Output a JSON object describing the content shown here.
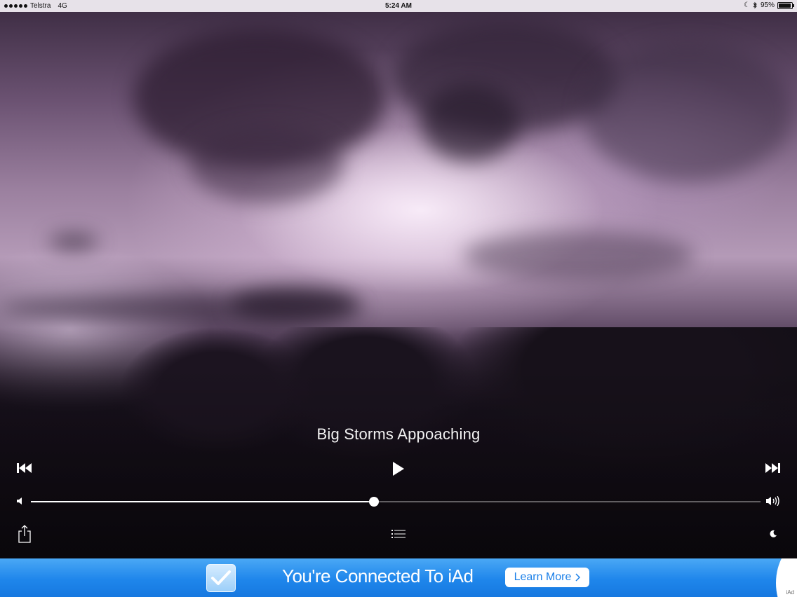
{
  "status_bar": {
    "carrier": "Telstra",
    "network": "4G",
    "time": "5:24 AM",
    "battery_text": "95%",
    "battery_level": 0.95
  },
  "player": {
    "track_title": "Big Storms Appoaching",
    "volume_level": 0.47
  },
  "ad": {
    "headline": "You're Connected To iAd",
    "learn_more_label": "Learn More",
    "badge": "iAd",
    "brand_color": "#1f86eb"
  },
  "icons": {
    "prev": "skip-back-icon",
    "play": "play-icon",
    "next": "skip-forward-icon",
    "volume_low": "speaker-low-icon",
    "volume_high": "speaker-high-icon",
    "share": "share-icon",
    "list": "list-icon",
    "sleep": "moon-icon"
  }
}
